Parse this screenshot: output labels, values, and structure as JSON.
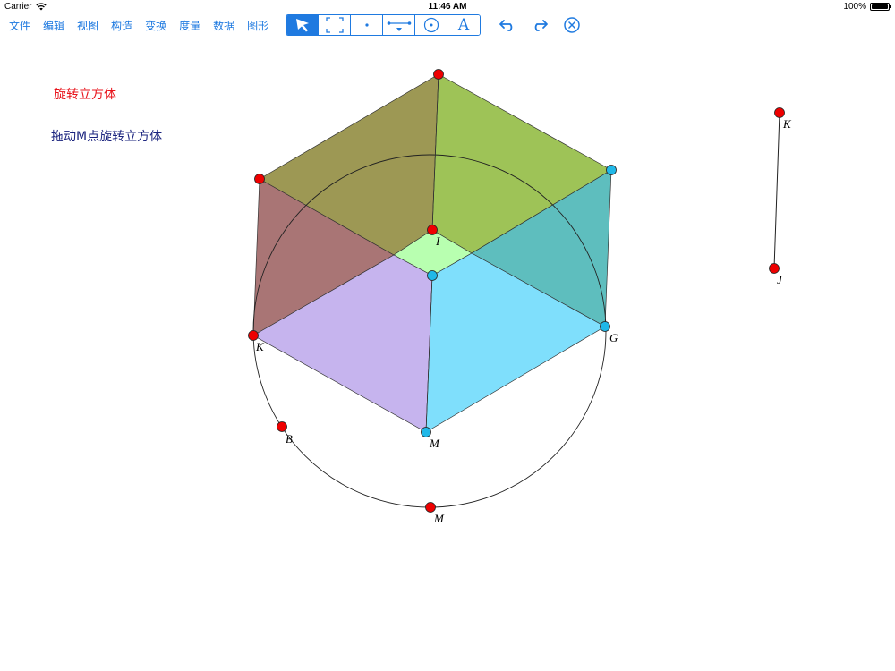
{
  "status": {
    "carrier": "Carrier",
    "time": "11:46 AM",
    "battery": "100%",
    "battery_level": 1.0
  },
  "menu": {
    "items": [
      "文件",
      "编辑",
      "视图",
      "构造",
      "变换",
      "度量",
      "数据",
      "图形"
    ]
  },
  "tools": {
    "items": [
      {
        "name": "select-arrow-icon",
        "active": true
      },
      {
        "name": "marquee-select-icon",
        "active": false
      },
      {
        "name": "point-tool-icon",
        "active": false
      },
      {
        "name": "segment-tool-icon",
        "active": false
      },
      {
        "name": "circle-tool-icon",
        "active": false
      },
      {
        "name": "text-tool-icon",
        "active": false,
        "glyph": "A"
      }
    ]
  },
  "actions": {
    "items": [
      "undo-icon",
      "redo-icon",
      "clear-icon"
    ]
  },
  "canvas_text": {
    "title": "旋转立方体",
    "hint": "拖动M点旋转立方体"
  },
  "point_labels": {
    "I": "I",
    "K_left": "K",
    "G": "G",
    "M_cube": "M",
    "B": "B",
    "M_circle": "M",
    "K_right": "K",
    "J": "J"
  },
  "colors": {
    "accent": "#1f7ae0",
    "title_red": "#e8141c",
    "hint_navy": "#1a237e",
    "point_red": "#ee0000",
    "point_cyan": "#20b8e8",
    "face_olive": "#8f8a3c",
    "face_green": "#8db83a",
    "face_maroon": "#9a5d5d",
    "face_teal": "#3bb0b0",
    "face_lime": "#b8ffb0",
    "face_lavender": "#c6b4ee",
    "face_sky": "#7fdffc"
  }
}
